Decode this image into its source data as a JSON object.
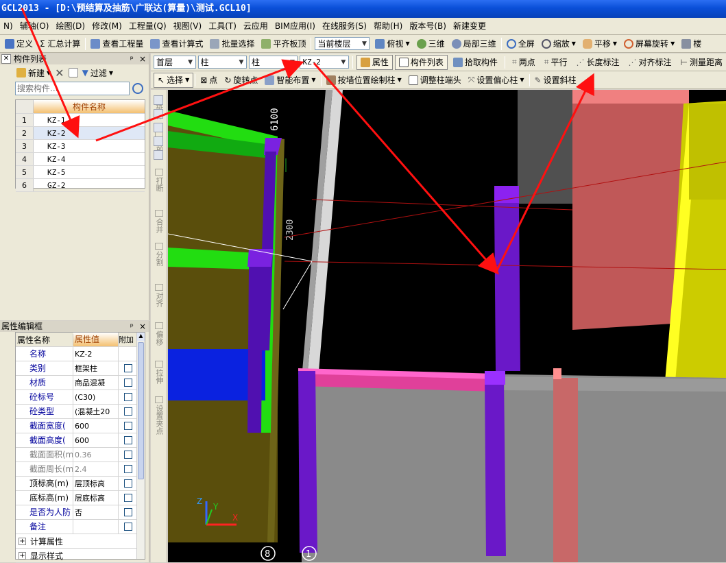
{
  "title": "GCL2013 - [D:\\预结算及抽筋\\广联达(算量)\\测试.GCL10]",
  "menu": [
    "N)",
    "辅轴(O)",
    "绘图(D)",
    "修改(M)",
    "工程量(Q)",
    "视图(V)",
    "工具(T)",
    "云应用",
    "BIM应用(I)",
    "在线服务(S)",
    "帮助(H)",
    "版本号(B)",
    "新建变更"
  ],
  "toolbar1": {
    "items": [
      "定义",
      "Σ 汇总计算",
      "查看工程量",
      "查看计算式",
      "批量选择",
      "平齐板顶"
    ],
    "floor_combo": "当前楼层",
    "view_items": [
      "俯视",
      "三维",
      "局部三维",
      "全屏",
      "缩放",
      "平移",
      "屏幕旋转"
    ],
    "tail": "楼"
  },
  "toolbar2": {
    "combos": [
      "首层",
      "柱",
      "柱",
      "KZ-2"
    ],
    "items": [
      "属性",
      "构件列表",
      "拾取构件",
      "两点",
      "平行",
      "长度标注",
      "对齐标注",
      "测量距离"
    ]
  },
  "toolbar3": {
    "items": [
      "选择",
      "点",
      "旋转点",
      "智能布置",
      "按墙位置绘制柱",
      "调整柱端头",
      "设置偏心柱",
      "设置斜柱"
    ]
  },
  "component_panel": {
    "title": "构件列表",
    "new_label": "新建",
    "filter_label": "过滤",
    "search_placeholder": "搜索构件...",
    "column_header": "构件名称",
    "rows": [
      {
        "num": "1",
        "name": "KZ-1"
      },
      {
        "num": "2",
        "name": "KZ-2"
      },
      {
        "num": "3",
        "name": "KZ-3"
      },
      {
        "num": "4",
        "name": "KZ-4"
      },
      {
        "num": "5",
        "name": "KZ-5"
      },
      {
        "num": "6",
        "name": "GZ-2"
      }
    ],
    "selected_index": 1
  },
  "property_panel": {
    "title": "属性编辑框",
    "headers": {
      "name": "属性名称",
      "value": "属性值",
      "extra": "附加"
    },
    "rows": [
      {
        "name": "名称",
        "value": "KZ-2",
        "style": "blue"
      },
      {
        "name": "类别",
        "value": "框架柱",
        "style": "blue"
      },
      {
        "name": "材质",
        "value": "商品混凝",
        "style": "blue"
      },
      {
        "name": "砼标号",
        "value": "(C30)",
        "style": "blue"
      },
      {
        "name": "砼类型",
        "value": "(混凝土20",
        "style": "blue"
      },
      {
        "name": "截面宽度(",
        "value": "600",
        "style": "blue"
      },
      {
        "name": "截面高度(",
        "value": "600",
        "style": "blue"
      },
      {
        "name": "截面面积(m",
        "value": "0.36",
        "style": "gray"
      },
      {
        "name": "截面周长(m",
        "value": "2.4",
        "style": "gray"
      },
      {
        "name": "顶标高(m)",
        "value": "层顶标高",
        "style": "black"
      },
      {
        "name": "底标高(m)",
        "value": "层底标高",
        "style": "black"
      },
      {
        "name": "是否为人防",
        "value": "否",
        "style": "blue"
      },
      {
        "name": "备注",
        "value": "",
        "style": "blue"
      }
    ],
    "groups": [
      "计算属性",
      "显示样式"
    ]
  },
  "vertical_toolbar": [
    "延伸",
    "修剪",
    "打断",
    "合并",
    "分割",
    "对齐",
    "偏移",
    "拉伸",
    "设置夹点"
  ],
  "canvas": {
    "dim_labels": [
      "6100",
      "2300"
    ],
    "axis_labels": [
      "8",
      "1"
    ],
    "axis_x": "X",
    "axis_y": "Y",
    "axis_z": "Z"
  }
}
